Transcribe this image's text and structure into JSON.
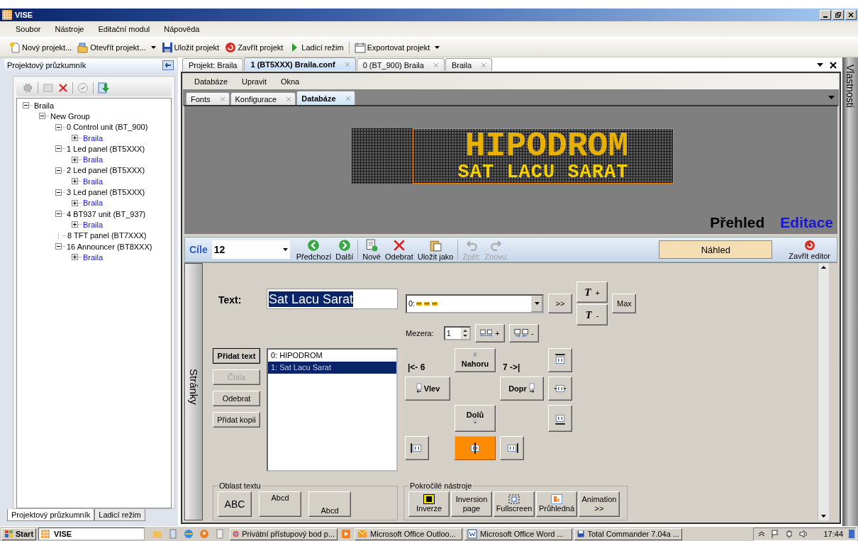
{
  "window": {
    "title": "VISE"
  },
  "menu": [
    {
      "label": "Soubor"
    },
    {
      "label": "Nástroje"
    },
    {
      "label": "Editační modul"
    },
    {
      "label": "Nápověda"
    }
  ],
  "toolbar": [
    {
      "kind": "new",
      "label": "Nový projekt...",
      "dropdown": false
    },
    {
      "kind": "open",
      "label": "Otevřít projekt...",
      "dropdown": true
    },
    {
      "kind": "save",
      "label": "Uložit projekt",
      "dropdown": false
    },
    {
      "kind": "close",
      "label": "Zavřít projekt",
      "dropdown": false
    },
    {
      "kind": "debug",
      "label": "Ladicí režim",
      "dropdown": false
    },
    {
      "kind": "export",
      "label": "Exportovat projekt",
      "dropdown": true
    }
  ],
  "explorer": {
    "title": "Projektový průzkumník",
    "tree": [
      {
        "link": false,
        "label": "Braila",
        "expanded": true,
        "children": [
          {
            "link": false,
            "label": "New Group",
            "expanded": true,
            "children": [
              {
                "link": false,
                "label": "0 Control unit (BT_900)",
                "expanded": true,
                "children": [
                  {
                    "link": true,
                    "label": "Braila",
                    "expanded": false
                  }
                ]
              },
              {
                "link": false,
                "label": "1 Led panel (BT5XXX)",
                "expanded": true,
                "children": [
                  {
                    "link": true,
                    "label": "Braila",
                    "expanded": false
                  }
                ]
              },
              {
                "link": false,
                "label": "2 Led panel (BT5XXX)",
                "expanded": true,
                "children": [
                  {
                    "link": true,
                    "label": "Braila",
                    "expanded": false
                  }
                ]
              },
              {
                "link": false,
                "label": "3 Led panel (BT5XXX)",
                "expanded": true,
                "children": [
                  {
                    "link": true,
                    "label": "Braila",
                    "expanded": false
                  }
                ]
              },
              {
                "link": false,
                "label": "4 BT937 unit (BT_937)",
                "expanded": true,
                "children": [
                  {
                    "link": true,
                    "label": "Braila",
                    "expanded": false
                  }
                ]
              },
              {
                "link": false,
                "label": "8 TFT panel (BT7XXX)"
              },
              {
                "link": false,
                "label": "16 Announcer (BT8XXX)",
                "expanded": true,
                "children": [
                  {
                    "link": true,
                    "label": "Braila",
                    "expanded": false
                  }
                ]
              }
            ]
          }
        ]
      }
    ],
    "tabs": [
      {
        "label": "Projektový průzkumník",
        "selected": true
      },
      {
        "label": "Ladicí režim",
        "selected": false
      }
    ]
  },
  "doc_tabs": [
    {
      "label": "Projekt:  Braila",
      "selected": false,
      "closable": false
    },
    {
      "label": "1 (BT5XXX) Braila.conf",
      "selected": true,
      "closable": true
    },
    {
      "label": "0 (BT_900) Braila",
      "selected": false,
      "closable": true
    },
    {
      "label": "Braila",
      "selected": false,
      "closable": true
    }
  ],
  "doc_menu": [
    {
      "label": "Databáze"
    },
    {
      "label": "Upravit"
    },
    {
      "label": "Okna"
    }
  ],
  "inner_tabs": [
    {
      "label": "Fonts",
      "selected": false
    },
    {
      "label": "Konfigurace",
      "selected": false
    },
    {
      "label": "Databáze",
      "selected": true
    }
  ],
  "preview": {
    "display_lines": [
      "HIPODROM",
      "SAT LACU SARAT"
    ],
    "modes": [
      {
        "label": "Přehled",
        "selected": false
      },
      {
        "label": "Editace",
        "selected": true
      }
    ]
  },
  "editor": {
    "target": {
      "label": "Cíle",
      "value": "12"
    },
    "actions": [
      {
        "kind": "prev",
        "label": "Předchozí",
        "disabled": false
      },
      {
        "kind": "next",
        "label": "Další",
        "disabled": false
      },
      {
        "kind": "new",
        "label": "Nové",
        "disabled": false
      },
      {
        "kind": "delete",
        "label": "Odebrat",
        "disabled": false
      },
      {
        "kind": "save_as",
        "label": "Uložit jako",
        "disabled": false
      },
      {
        "kind": "undo",
        "label": "Zpět:",
        "disabled": true
      },
      {
        "kind": "redo",
        "label": "Znovu:",
        "disabled": true
      }
    ],
    "preview_button": "Náhled",
    "close_button": "Zavřít editor",
    "side_tab": "Stránky",
    "text_label": "Text:",
    "text_value": "Sat Lacu Sarat",
    "font": {
      "value": "0:"
    },
    "next_button": ">>",
    "size_buttons": [
      {
        "glyph": "T",
        "sign": "+"
      },
      {
        "glyph": "T",
        "sign": "-"
      }
    ],
    "max_button": "Max",
    "spacing": {
      "label": "Mezera:",
      "value": "1",
      "buttons": [
        {
          "kind": "wider",
          "sign": "+"
        },
        {
          "kind": "narrower",
          "sign": "-"
        }
      ]
    },
    "list_buttons": [
      {
        "label": "Přidat text",
        "default": true,
        "disabled": false
      },
      {
        "label": "Čísla",
        "default": false,
        "disabled": true
      },
      {
        "label": "Odebrat",
        "default": false,
        "disabled": false
      },
      {
        "label": "Přidat kopii",
        "default": false,
        "disabled": false
      }
    ],
    "texts": [
      {
        "label": "0: HIPODROM",
        "selected": false
      },
      {
        "label": "1: Sat Lacu Sarat",
        "selected": true
      }
    ],
    "left_limit": "|<- 6",
    "right_limit": "7 ->|",
    "moves": [
      {
        "kind": "up",
        "label": "Nahoru"
      },
      {
        "kind": "left",
        "label": "Vlev"
      },
      {
        "kind": "right",
        "label": "Dopr"
      },
      {
        "kind": "down",
        "label": "Dolů"
      }
    ],
    "alignment": [
      {
        "kind": "top",
        "selected": false
      },
      {
        "kind": "middle",
        "selected": false
      },
      {
        "kind": "bottom",
        "selected": false
      },
      {
        "kind": "left",
        "selected": false
      },
      {
        "kind": "center",
        "selected": true
      },
      {
        "kind": "right",
        "selected": false
      }
    ],
    "text_area": {
      "title": "Oblast textu",
      "buttons": [
        {
          "kind": "large",
          "label": "ABC"
        },
        {
          "kind": "top",
          "label": "Abcd"
        },
        {
          "kind": "bottom",
          "label": "Abcd"
        }
      ]
    },
    "advanced": {
      "title": "Pokročilé nástroje",
      "buttons": [
        {
          "kind": "inverse",
          "label": "Inverze"
        },
        {
          "kind": "plain",
          "label": "Inversion page"
        },
        {
          "kind": "fullscreen",
          "label": "Fullscreen"
        },
        {
          "kind": "transparent",
          "label": "Průhledná"
        },
        {
          "kind": "plain",
          "label": "Animation >>"
        }
      ]
    }
  },
  "side_panel": {
    "title": "Vlastnosti"
  },
  "taskbar": {
    "start": "Start",
    "address": "VISE",
    "windows": [
      {
        "kind": "browser",
        "label": "Privátní přístupový bod p...",
        "selected": false
      },
      {
        "kind": "mail",
        "label": "Microsoft Office Outloo...",
        "selected": false
      },
      {
        "kind": "word",
        "label": "Microsoft Office Word ...",
        "selected": false
      },
      {
        "kind": "disk",
        "label": "Total Commander 7.04a ...",
        "selected": false
      }
    ],
    "clock": "17:44"
  }
}
